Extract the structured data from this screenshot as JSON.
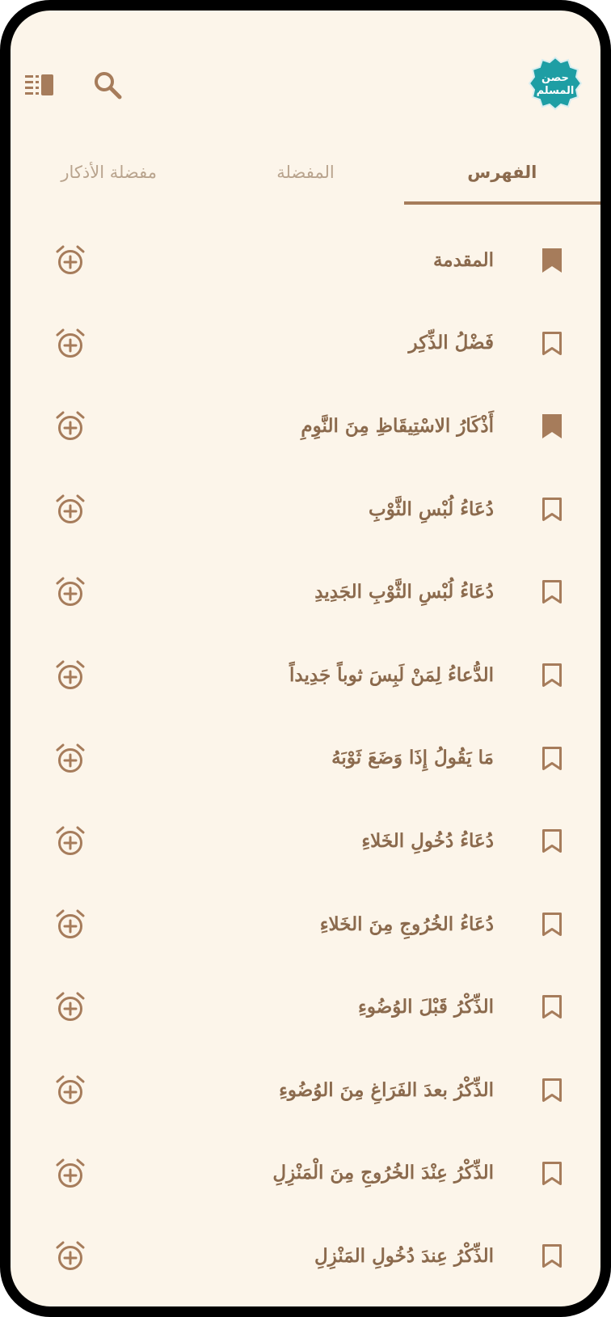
{
  "app": {
    "logo_text_line1": "حصن",
    "logo_text_line2": "المسلم",
    "menu_icon": "sidebar-list-icon",
    "search_icon": "search-icon"
  },
  "colors": {
    "background": "#fcf5ea",
    "accent": "#a67c5b",
    "text": "#8b6a4d",
    "inactive": "#b9a48e",
    "logo": "#1e9ea4"
  },
  "tabs": [
    {
      "label": "الفهرس",
      "active": true
    },
    {
      "label": "المفضلة",
      "active": false
    },
    {
      "label": "مفضلة الأذكار",
      "active": false
    }
  ],
  "items": [
    {
      "title": "المقدمة",
      "bookmarked": true
    },
    {
      "title": "فَضْلُ الذِّكِر",
      "bookmarked": false
    },
    {
      "title": "أَذْكَارُ الاسْتِيقَاظِ مِنَ النَّوِمِ",
      "bookmarked": true
    },
    {
      "title": "دُعَاءُ لُبْسِ الثَّوْبِ",
      "bookmarked": false
    },
    {
      "title": "دُعَاءُ لُبْسِ الثَّوْبِ الجَدِيدِ",
      "bookmarked": false
    },
    {
      "title": "الدُّعاءُ لِمَنْ لَبِسَ ثوباً جَدِيداً",
      "bookmarked": false
    },
    {
      "title": "مَا يَقُولُ إِذَا وَضَعَ ثَوْبَهُ",
      "bookmarked": false
    },
    {
      "title": "دُعَاءُ دُخُولِ الخَلاءِ",
      "bookmarked": false
    },
    {
      "title": "دُعَاءُ الخُرُوجِ مِنَ الخَلاءِ",
      "bookmarked": false
    },
    {
      "title": "الذِّكْرُ قَبْلَ الوُضُوءِ",
      "bookmarked": false
    },
    {
      "title": "الذِّكْرُ بعدَ الفَرَاغِ مِنَ الوُضُوءِ",
      "bookmarked": false
    },
    {
      "title": "الذِّكْرُ عِنْدَ الخُرُوجِ مِنَ الْمَنْزِلِ",
      "bookmarked": false
    },
    {
      "title": "الذِّكْرُ عِندَ دُخُولِ المَنْزِلِ",
      "bookmarked": false
    }
  ]
}
